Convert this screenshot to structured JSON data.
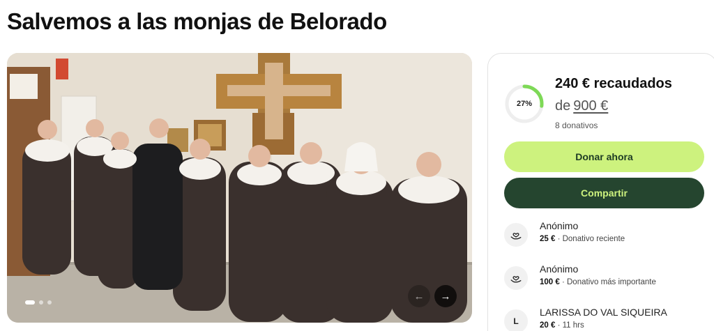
{
  "page": {
    "title": "Salvemos a las monjas de Belorado"
  },
  "gallery": {
    "slide_count": 3,
    "active_slide": 1,
    "prev_icon": "arrow-left-icon",
    "next_icon": "arrow-right-icon"
  },
  "summary": {
    "percent_label": "27%",
    "percent_value": 0.27,
    "raised_label": "240 € recaudados",
    "goal_prefix": "de",
    "goal_amount": "900 €",
    "donations_count": "8 donativos"
  },
  "actions": {
    "donate_label": "Donar ahora",
    "share_label": "Compartir"
  },
  "donors": [
    {
      "name": "Anónimo",
      "amount": "25 €",
      "detail": " · Donativo reciente",
      "avatar": "heart-hand-icon"
    },
    {
      "name": "Anónimo",
      "amount": "100 €",
      "detail": " · Donativo más importante",
      "avatar": "heart-hand-icon"
    },
    {
      "name": "LARISSA DO VAL SIQUEIRA",
      "amount": "20 €",
      "detail": " · 11 hrs",
      "avatar_letter": "L"
    }
  ],
  "colors": {
    "accent_light": "#cdf27e",
    "accent_dark": "#25452f",
    "progress_track": "#eeeeee",
    "progress_fill": "#7ed957"
  }
}
